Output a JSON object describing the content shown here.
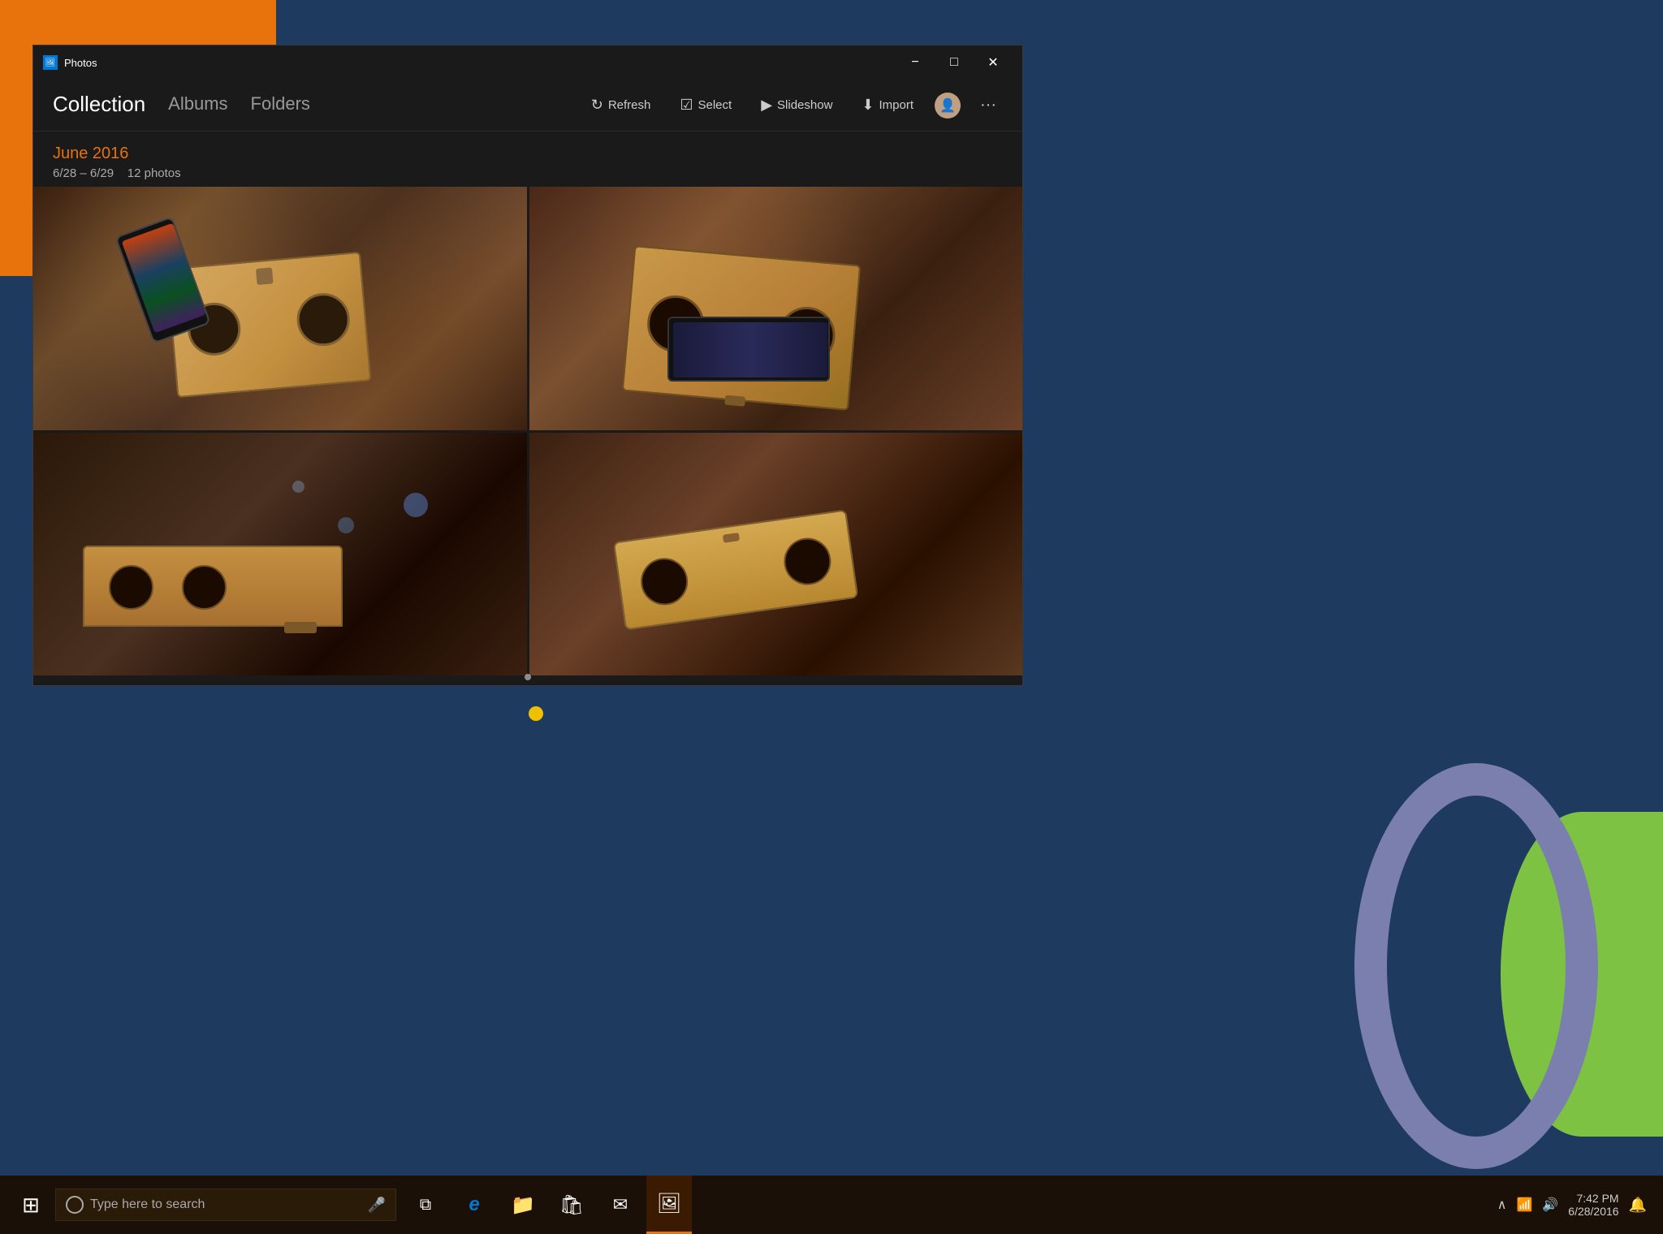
{
  "desktop": {
    "bg_color": "#1e3a5f"
  },
  "window": {
    "title": "Photos",
    "controls": {
      "minimize": "−",
      "maximize": "□",
      "close": "✕"
    }
  },
  "nav": {
    "tabs": [
      {
        "label": "Collection",
        "active": true
      },
      {
        "label": "Albums",
        "active": false
      },
      {
        "label": "Folders",
        "active": false
      }
    ],
    "actions": [
      {
        "label": "Refresh",
        "icon": "↻"
      },
      {
        "label": "Select",
        "icon": "☑"
      },
      {
        "label": "Slideshow",
        "icon": "▶"
      },
      {
        "label": "Import",
        "icon": "⬇"
      }
    ]
  },
  "content": {
    "month": "June 2016",
    "date_range": "6/28 – 6/29",
    "photo_count": "12 photos",
    "photos": [
      {
        "id": 1,
        "alt": "Cardboard VR with phone - front view"
      },
      {
        "id": 2,
        "alt": "Cardboard VR without phone - side view"
      },
      {
        "id": 3,
        "alt": "Cardboard VR bottom angle"
      },
      {
        "id": 4,
        "alt": "Cardboard VR side bottom angle"
      }
    ]
  },
  "taskbar": {
    "search_placeholder": "Type here to search",
    "start_icon": "⊞",
    "icons": [
      {
        "name": "task-view",
        "symbol": "⧉"
      },
      {
        "name": "edge",
        "symbol": "e"
      },
      {
        "name": "file-explorer",
        "symbol": "📁"
      },
      {
        "name": "store",
        "symbol": "🛍"
      },
      {
        "name": "mail",
        "symbol": "✉"
      },
      {
        "name": "photos",
        "symbol": "🖼"
      }
    ]
  },
  "notification": {
    "dot_color": "#f0c000"
  }
}
